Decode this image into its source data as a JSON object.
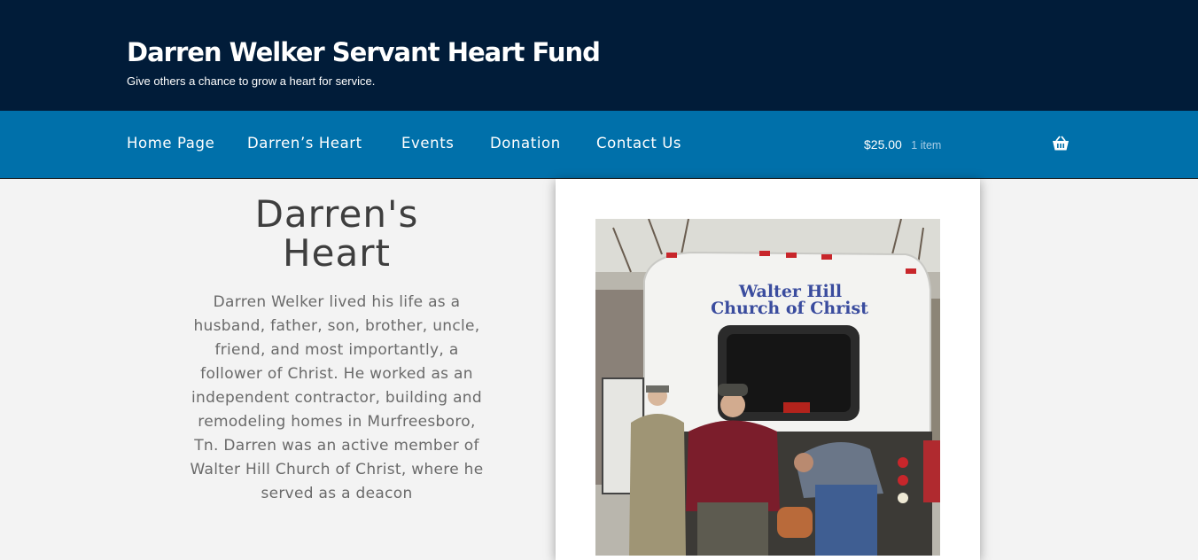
{
  "header": {
    "site_title": "Darren Welker Servant Heart Fund",
    "tagline": "Give others a chance to grow a heart for service."
  },
  "nav": {
    "items": [
      {
        "label": "Home Page"
      },
      {
        "label": "Darren’s Heart"
      },
      {
        "label": "Events"
      },
      {
        "label": "Donation"
      },
      {
        "label": "Contact Us"
      }
    ],
    "cart": {
      "total": "$25.00",
      "count": "1 item",
      "icon": "basket-icon"
    }
  },
  "main": {
    "heading_line1": "Darren's",
    "heading_line2": "Heart",
    "body": "Darren Welker lived his life as a husband, father, son, brother, uncle, friend, and most importantly, a follower of Christ. He worked as an independent contractor, building and remodeling homes in Murfreesboro, Tn. Darren was an active member of Walter Hill Church of Christ, where he served as a deacon",
    "photo": {
      "bus_text_line1": "Walter Hill",
      "bus_text_line2": "Church of Christ"
    }
  },
  "colors": {
    "header_bg": "#011c39",
    "nav_bg": "#0070aa",
    "page_bg": "#f3f3f3",
    "heading": "#3e3e3e",
    "body_text": "#6a6a6a"
  }
}
